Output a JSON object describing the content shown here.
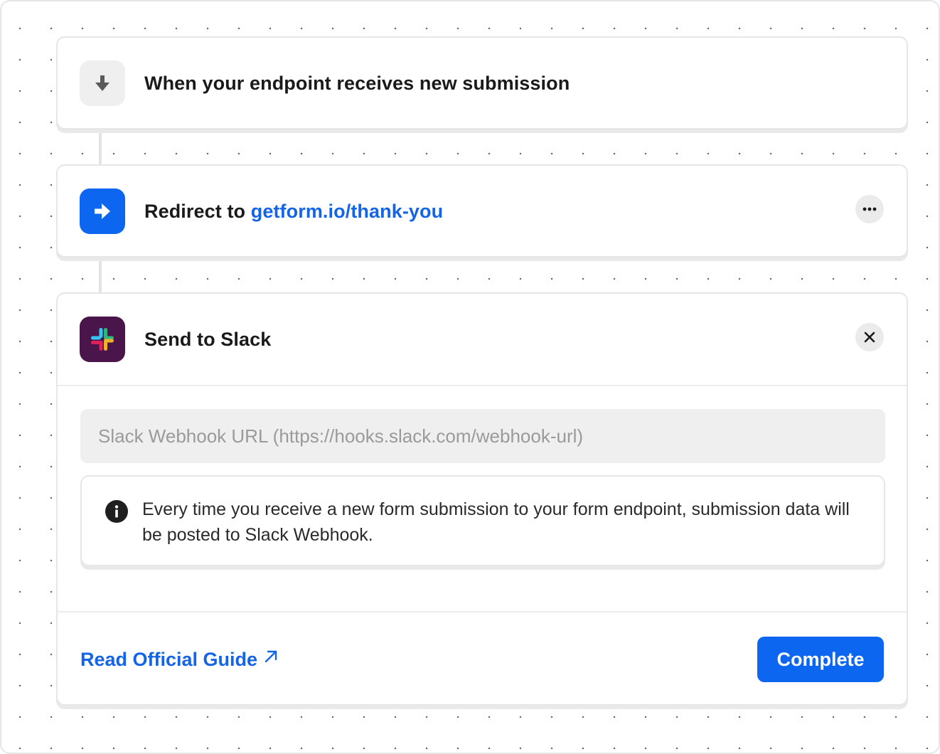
{
  "flow": {
    "trigger": {
      "icon": "arrow-down-icon",
      "title": "When your endpoint receives new submission"
    },
    "redirect": {
      "icon": "arrow-right-icon",
      "label": "Redirect to",
      "url": "getform.io/thank-you",
      "menu_icon": "more-horizontal-icon"
    },
    "slack": {
      "icon": "slack-logo-icon",
      "title": "Send to Slack",
      "close_icon": "close-icon",
      "webhook_placeholder": "Slack Webhook URL (https://hooks.slack.com/webhook-url)",
      "webhook_value": "",
      "info_icon": "info-icon",
      "info_text": "Every time you receive a new form submission to your form endpoint, submission data will be posted to Slack Webhook.",
      "guide_label": "Read Official Guide",
      "guide_icon": "external-link-arrow-icon",
      "complete_label": "Complete"
    }
  },
  "colors": {
    "accent": "#0c66f0",
    "link": "#1464e8",
    "slack_bg": "#4a154b"
  }
}
